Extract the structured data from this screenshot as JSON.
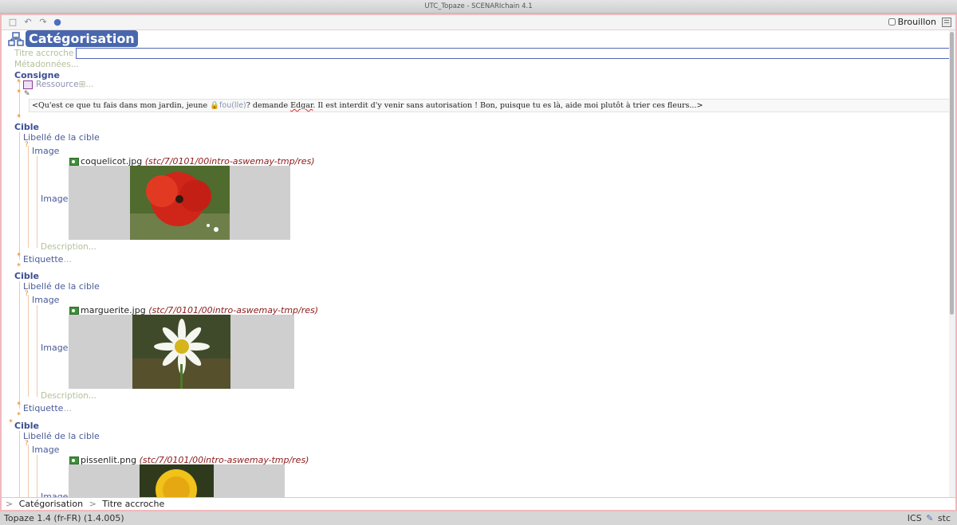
{
  "window": {
    "title": "UTC_Topaze - SCENARIchain 4.1"
  },
  "toolbar": {
    "draft_label": "Brouillon"
  },
  "doc": {
    "title": "Catégorisation",
    "accroche_label": "Titre accroche",
    "meta_label": "Métadonnées",
    "ellipsis": "...",
    "consigne": {
      "heading": "Consigne",
      "ressource_label": "Ressource",
      "text_before": "<Qu'est ce que tu fais dans mon jardin, jeune ",
      "chip": "fou(lle)",
      "text_mid": "? demande ",
      "name": "Edgar",
      "text_after": ". Il est interdit d'y venir sans autorisation ! Bon, puisque tu es là, aide moi plutôt à trier ces fleurs...>"
    },
    "cibles": [
      {
        "heading": "Cible",
        "libelle": "Libellé de la cible",
        "image_label": "Image",
        "file": "coquelicot.jpg",
        "path": "(stc/7/0101/00intro-aswemay-tmp/res)",
        "description_label": "Description",
        "etiquette_label": "Etiquette",
        "img_color": "#c4281a"
      },
      {
        "heading": "Cible",
        "libelle": "Libellé de la cible",
        "image_label": "Image",
        "file": "marguerite.jpg",
        "path": "(stc/7/0101/00intro-aswemay-tmp/res)",
        "description_label": "Description",
        "etiquette_label": "Etiquette",
        "img_color": "#f2f2ec"
      },
      {
        "heading": "Cible",
        "libelle": "Libellé de la cible",
        "image_label": "Image",
        "file": "pissenlit.png",
        "path": "(stc/7/0101/00intro-aswemay-tmp/res)",
        "img_color": "#f0c21a"
      }
    ]
  },
  "breadcrumb": {
    "items": [
      "Catégorisation",
      "Titre accroche"
    ],
    "separator": ">"
  },
  "status": {
    "left": "Topaze 1.4 (fr-FR) (1.4.005)",
    "ics": "ICS",
    "user": "stc"
  },
  "icons": [
    "save-icon",
    "undo-icon",
    "redo-icon",
    "help-icon",
    "categorisation-icon",
    "resource-icon",
    "image-icon",
    "pencil-icon"
  ]
}
